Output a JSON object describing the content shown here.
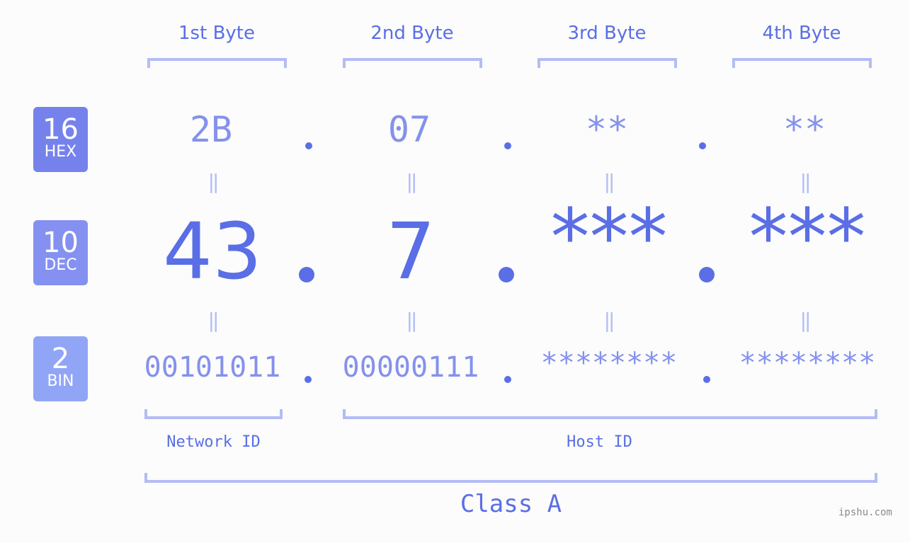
{
  "bytes": [
    {
      "label": "1st Byte",
      "hex": "2B",
      "dec": "43",
      "bin": "00101011"
    },
    {
      "label": "2nd Byte",
      "hex": "07",
      "dec": "7",
      "bin": "00000111"
    },
    {
      "label": "3rd Byte",
      "hex": "**",
      "dec": "***",
      "bin": "********"
    },
    {
      "label": "4th Byte",
      "hex": "**",
      "dec": "***",
      "bin": "********"
    }
  ],
  "badges": {
    "hex": {
      "num": "16",
      "label": "HEX",
      "color": "#7682ec"
    },
    "dec": {
      "num": "10",
      "label": "DEC",
      "color": "#8591f0"
    },
    "bin": {
      "num": "2",
      "label": "BIN",
      "color": "#91a5f7"
    }
  },
  "equals_symbol": "||",
  "segments": {
    "network": "Network ID",
    "host": "Host ID",
    "class": "Class A"
  },
  "watermark": "ipshu.com",
  "colors": {
    "primary": "#5a6ee6",
    "secondary": "#8591ec",
    "bracket": "#b3bcf5"
  }
}
